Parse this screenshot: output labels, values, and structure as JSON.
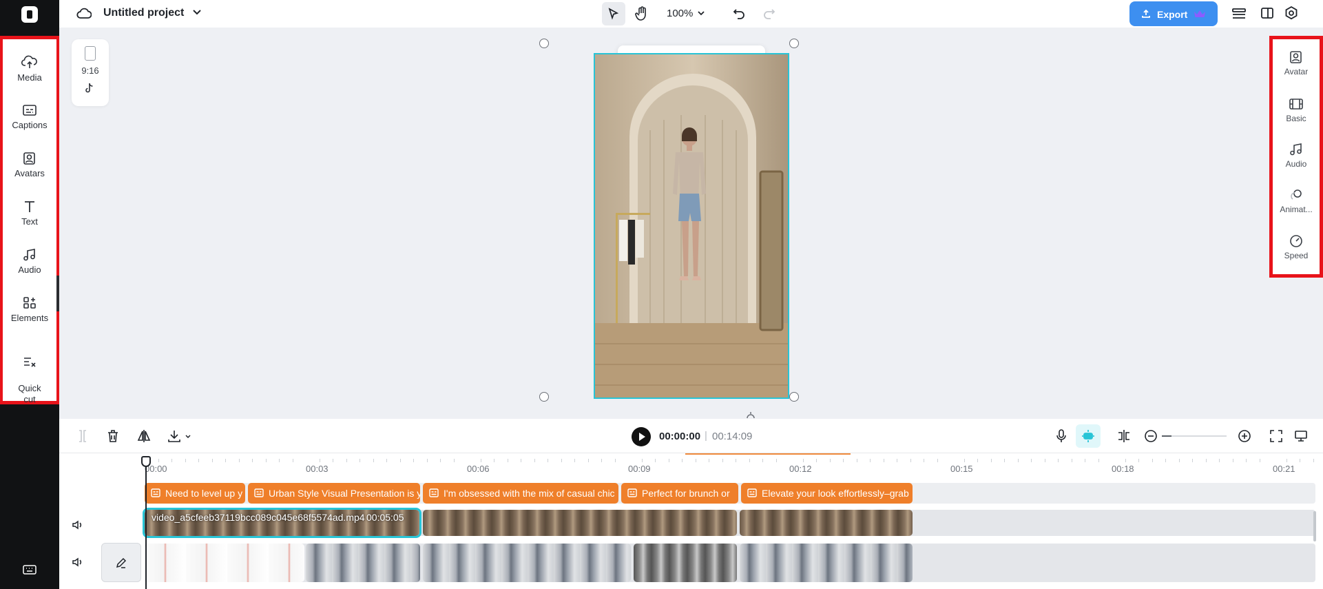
{
  "app": {
    "project_title": "Untitled project",
    "zoom": "100%",
    "export_label": "Export"
  },
  "left_nav": [
    {
      "label": "Media",
      "icon": "cloud-upload-icon"
    },
    {
      "label": "Captions",
      "icon": "captions-icon"
    },
    {
      "label": "Avatars",
      "icon": "avatar-icon"
    },
    {
      "label": "Text",
      "icon": "text-icon"
    },
    {
      "label": "Audio",
      "icon": "music-note-icon"
    },
    {
      "label": "Elements",
      "icon": "elements-icon"
    },
    {
      "label": "Quick\ncut",
      "icon": "quick-cut-icon"
    }
  ],
  "right_nav": [
    {
      "label": "Avatar",
      "icon": "avatar-icon"
    },
    {
      "label": "Basic",
      "icon": "film-icon"
    },
    {
      "label": "Audio",
      "icon": "music-note-icon"
    },
    {
      "label": "Animat...",
      "icon": "animation-icon"
    },
    {
      "label": "Speed",
      "icon": "speed-icon"
    }
  ],
  "canvas": {
    "aspect_ratio": "9:16",
    "platform_icon": "tiktok-icon"
  },
  "playback": {
    "current_time": "00:00:00",
    "separator": "|",
    "total_time": "00:14:09"
  },
  "timeline": {
    "ruler_labels": [
      "00:00",
      "00:03",
      "00:06",
      "00:09",
      "00:12",
      "00:15",
      "00:18",
      "00:21"
    ],
    "captions": [
      "Need to level up y",
      "Urban Style Visual Presentation is y",
      "I'm obsessed with the mix of casual chic",
      "Perfect for brunch or",
      "Elevate your look effortlessly–grab"
    ],
    "main_clip_name": "video_a5cfeeb37119bcc089c045e68f5574ad.mp4",
    "main_clip_duration": "00:05:05"
  },
  "colors": {
    "accent_teal": "#28c4d6",
    "caption_orange": "#ef7f2a",
    "export_blue": "#3d8ff0",
    "highlight_red": "#e8131a"
  }
}
